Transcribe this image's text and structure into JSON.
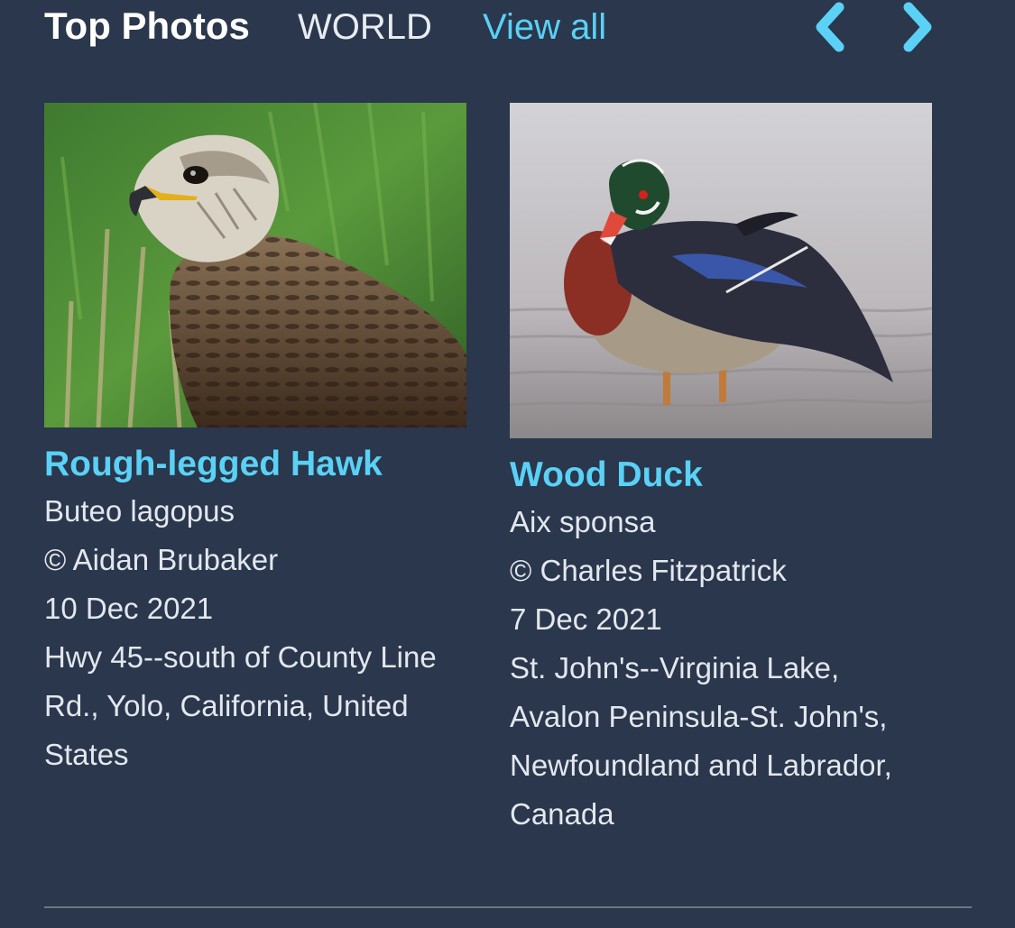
{
  "header": {
    "title": "Top Photos",
    "region": "WORLD",
    "view_all": "View all",
    "prev_icon": "chevron-left-icon",
    "next_icon": "chevron-right-icon"
  },
  "colors": {
    "background": "#2a374c",
    "accent": "#5ad1f5",
    "text": "#e3e7ee"
  },
  "photos": [
    {
      "common_name": "Rough-legged Hawk",
      "scientific_name": "Buteo lagopus",
      "credit": "© Aidan Brubaker",
      "date": "10 Dec 2021",
      "location": "Hwy 45--south of County Line Rd., Yolo, California, United States",
      "image_subject": "hawk-photo"
    },
    {
      "common_name": "Wood Duck",
      "scientific_name": "Aix sponsa",
      "credit": "© Charles Fitzpatrick",
      "date": "7 Dec 2021",
      "location": "St. John's--Virginia Lake, Avalon Peninsula-St. John's, Newfoundland and Labrador, Canada",
      "image_subject": "duck-photo"
    }
  ]
}
